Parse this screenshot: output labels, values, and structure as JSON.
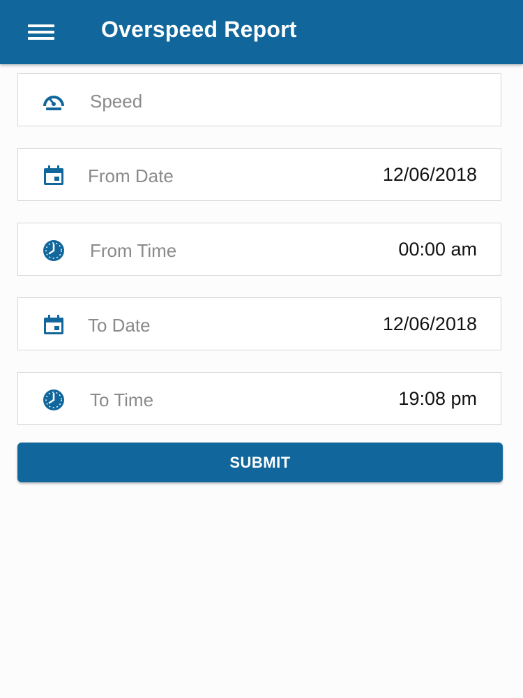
{
  "header": {
    "title": "Overspeed Report",
    "menu_icon": "hamburger-menu-icon"
  },
  "colors": {
    "primary": "#11679c",
    "label": "#8a8a8a",
    "value": "#111111"
  },
  "form": {
    "speed": {
      "label": "Speed",
      "value": "",
      "icon": "speedometer-icon"
    },
    "from_date": {
      "label": "From Date",
      "value": "12/06/2018",
      "icon": "calendar-icon"
    },
    "from_time": {
      "label": "From Time",
      "value": "00:00 am",
      "icon": "clock-icon"
    },
    "to_date": {
      "label": "To Date",
      "value": "12/06/2018",
      "icon": "calendar-icon"
    },
    "to_time": {
      "label": "To Time",
      "value": "19:08 pm",
      "icon": "clock-icon"
    }
  },
  "submit_label": "SUBMIT"
}
